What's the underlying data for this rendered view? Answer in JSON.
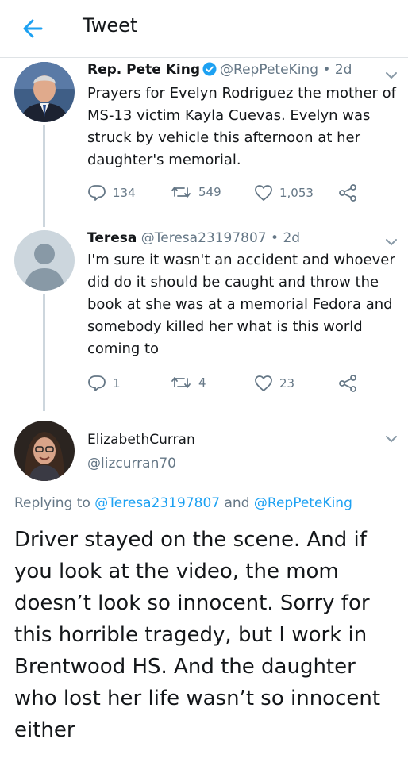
{
  "header": {
    "title": "Tweet"
  },
  "tweets": [
    {
      "name": "Rep. Pete King",
      "handle": "@RepPeteKing",
      "time": "• 2d",
      "text": "Prayers for Evelyn Rodriguez the mother of MS-13 victim Kayla Cuevas. Evelyn was struck by vehicle this afternoon at her daughter's memorial.",
      "replies": "134",
      "retweets": "549",
      "likes": "1,053"
    },
    {
      "name": "Teresa",
      "handle": "@Teresa23197807",
      "time": "• 2d",
      "text": "I'm sure it wasn't an accident and whoever did do it should be caught and throw the book at she was at a memorial Fedora and somebody killed her what is this world coming to",
      "replies": "1",
      "retweets": "4",
      "likes": "23"
    }
  ],
  "main_tweet": {
    "name": "ElizabethCurran",
    "handle": "@lizcurran70",
    "replying_prefix": "Replying to",
    "reply_user_1": "@Teresa23197807",
    "reply_and": "and",
    "reply_user_2": "@RepPeteKing",
    "text": "Driver stayed on the scene.  And if you look at the video,  the mom doesn’t look so innocent.  Sorry for this horrible tragedy, but I work in Brentwood HS.  And the daughter who lost her life wasn’t so innocent either"
  },
  "colors": {
    "accent": "#1da1f2",
    "muted": "#657786",
    "verified": "#1da1f2"
  },
  "icons": [
    "back-arrow-icon",
    "verified-badge-icon",
    "chevron-down-icon",
    "reply-icon",
    "retweet-icon",
    "like-icon",
    "share-icon",
    "default-avatar-icon"
  ]
}
